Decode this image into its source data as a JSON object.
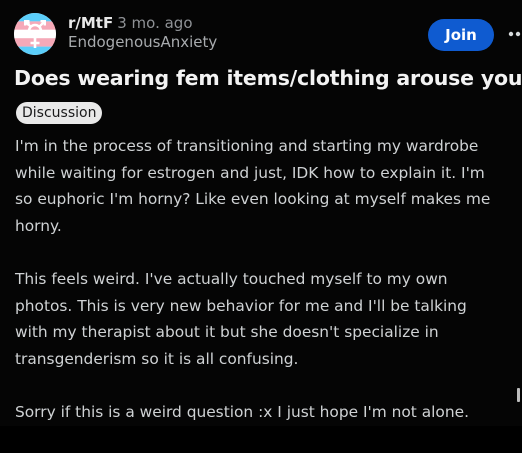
{
  "post": {
    "subreddit": "r/MtF",
    "time_ago": "3 mo. ago",
    "author": "EndogenousAnxiety",
    "join_label": "Join",
    "more_icon": "ellipsis-icon",
    "title": "Does wearing fem items/clothing arouse you?",
    "flair": "Discussion",
    "paragraphs": [
      {
        "lines": [
          "I'm in the process of transitioning and starting my wardrobe",
          "while waiting for estrogen and just, IDK how to explain it. I'm",
          "so euphoric I'm horny? Like even looking at myself makes me",
          "horny."
        ]
      },
      {
        "lines": [
          "This feels weird. I've actually touched myself to my own",
          "photos. This is very new behavior for me and I'll be talking",
          "with my therapist about it but she doesn't specialize in",
          "transgenderism so it is all confusing."
        ]
      },
      {
        "lines": [
          "Sorry if this is a weird question :x I just hope I'm not alone."
        ]
      }
    ]
  },
  "colors": {
    "background": "#050505",
    "join_button": "#0f5bd0",
    "flair_bg": "#e9e9e9",
    "trans_blue": "#5bcefa",
    "trans_pink": "#f5a9b8",
    "trans_white": "#ffffff"
  }
}
